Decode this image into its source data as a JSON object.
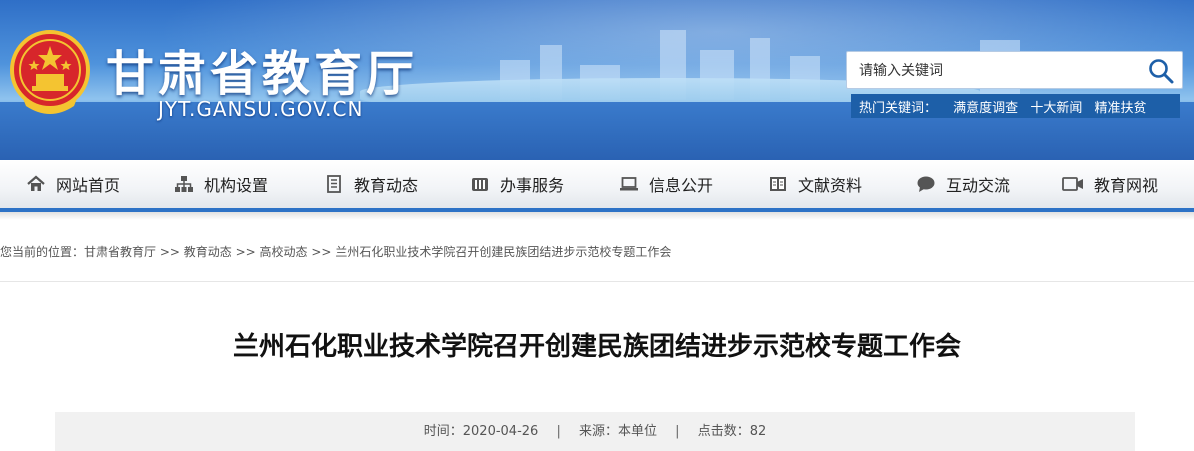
{
  "header": {
    "site_title": "甘肃省教育厅",
    "site_domain": "JYT.GANSU.GOV.CN",
    "search": {
      "placeholder": "请输入关键词"
    },
    "hot_keywords": {
      "label": "热门关键词：",
      "items": [
        "满意度调查",
        "十大新闻",
        "精准扶贫"
      ]
    }
  },
  "nav": {
    "items": [
      {
        "label": "网站首页",
        "icon": "home-icon"
      },
      {
        "label": "机构设置",
        "icon": "org-chart-icon"
      },
      {
        "label": "教育动态",
        "icon": "document-icon"
      },
      {
        "label": "办事服务",
        "icon": "folder-icon"
      },
      {
        "label": "信息公开",
        "icon": "laptop-icon"
      },
      {
        "label": "文献资料",
        "icon": "book-icon"
      },
      {
        "label": "互动交流",
        "icon": "chat-icon"
      },
      {
        "label": "教育网视",
        "icon": "video-icon"
      }
    ]
  },
  "breadcrumb": {
    "prefix": "您当前的位置：",
    "items": [
      "甘肃省教育厅",
      "教育动态",
      "高校动态",
      "兰州石化职业技术学院召开创建民族团结进步示范校专题工作会"
    ],
    "separator": " >> "
  },
  "article": {
    "title": "兰州石化职业技术学院召开创建民族团结进步示范校专题工作会",
    "meta": {
      "time_label": "时间：",
      "time": "2020-04-26",
      "source_label": "来源：",
      "source": "本单位",
      "clicks_label": "点击数：",
      "clicks": "82"
    }
  },
  "colors": {
    "nav_accent": "#2d72c6",
    "hot_bar": "#1d5fa8",
    "banner_blue": "#2f6fc7"
  }
}
